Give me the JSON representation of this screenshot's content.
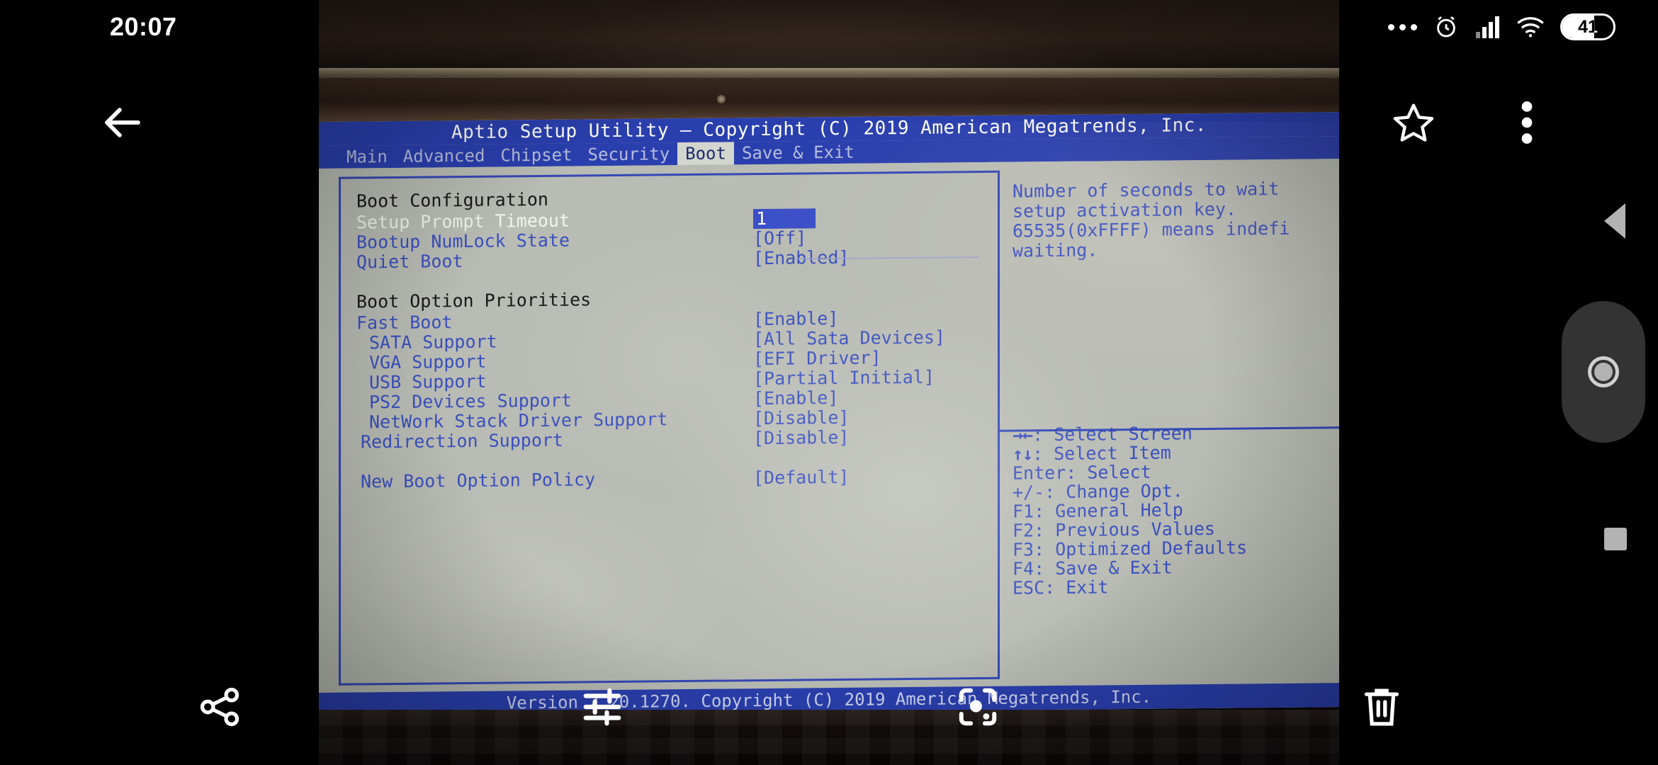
{
  "phone": {
    "status_bar": {
      "time": "20:07",
      "battery_percent": "41",
      "icons": [
        "more-dots-icon",
        "alarm-clock-icon",
        "signal-bars-icon",
        "wifi-icon",
        "battery-icon"
      ]
    },
    "top_actions": [
      {
        "name": "back-button",
        "icon": "arrow-left-icon"
      },
      {
        "name": "favorite-button",
        "icon": "star-icon"
      },
      {
        "name": "overflow-menu-button",
        "icon": "more-vertical-icon"
      }
    ],
    "bottom_actions": [
      {
        "name": "share-button",
        "icon": "share-icon"
      },
      {
        "name": "edit-button",
        "icon": "sliders-icon"
      },
      {
        "name": "lens-button",
        "icon": "google-lens-icon"
      },
      {
        "name": "delete-button",
        "icon": "trash-icon"
      }
    ],
    "nav_bar": [
      {
        "name": "nav-back-button",
        "icon": "triangle-left-icon"
      },
      {
        "name": "nav-home-button",
        "icon": "circle-icon"
      },
      {
        "name": "nav-recents-button",
        "icon": "square-icon"
      }
    ]
  },
  "bios": {
    "title": "Aptio Setup Utility – Copyright (C) 2019 American Megatrends, Inc.",
    "tabs": [
      {
        "label": "Main",
        "active": false
      },
      {
        "label": "Advanced",
        "active": false
      },
      {
        "label": "Chipset",
        "active": false
      },
      {
        "label": "Security",
        "active": false
      },
      {
        "label": "Boot",
        "active": true
      },
      {
        "label": "Save & Exit",
        "active": false
      }
    ],
    "sections": [
      {
        "heading": "Boot Configuration",
        "items": [
          {
            "label": "Setup Prompt Timeout",
            "value": "1",
            "selected": true,
            "indent": 0
          },
          {
            "label": "Bootup NumLock State",
            "value": "[Off]",
            "selected": false,
            "indent": 0
          },
          {
            "label": "Quiet Boot",
            "value": "[Enabled]",
            "selected": false,
            "indent": 0
          }
        ]
      },
      {
        "heading": "Boot Option Priorities",
        "items": [
          {
            "label": "Fast Boot",
            "value": "[Enable]",
            "selected": false,
            "indent": 0
          },
          {
            "label": "SATA Support",
            "value": "[All Sata Devices]",
            "selected": false,
            "indent": 1
          },
          {
            "label": "VGA Support",
            "value": "[EFI Driver]",
            "selected": false,
            "indent": 1
          },
          {
            "label": "USB Support",
            "value": "[Partial Initial]",
            "selected": false,
            "indent": 1
          },
          {
            "label": "PS2 Devices Support",
            "value": "[Enable]",
            "selected": false,
            "indent": 1
          },
          {
            "label": "NetWork Stack Driver Support",
            "value": "[Disable]",
            "selected": false,
            "indent": 1
          },
          {
            "label": "Redirection Support",
            "value": "[Disable]",
            "selected": false,
            "indent": 0
          },
          {
            "label": "",
            "value": "",
            "selected": false,
            "indent": 0
          },
          {
            "label": "New Boot Option Policy",
            "value": "[Default]",
            "selected": false,
            "indent": 0
          }
        ]
      }
    ],
    "help_lines": [
      "Number of seconds to wait",
      "setup activation key.",
      "65535(0xFFFF) means indefi",
      "waiting."
    ],
    "key_legend": [
      {
        "keys": "→←",
        "action": ": Select Screen"
      },
      {
        "keys": "↑↓",
        "action": ": Select Item"
      },
      {
        "keys": "Enter",
        "action": ": Select"
      },
      {
        "keys": "+/-",
        "action": ": Change Opt."
      },
      {
        "keys": "F1",
        "action": ": General Help"
      },
      {
        "keys": "F2",
        "action": ": Previous Values"
      },
      {
        "keys": "F3",
        "action": ": Optimized Defaults"
      },
      {
        "keys": "F4",
        "action": ": Save & Exit"
      },
      {
        "keys": "ESC",
        "action": ": Exit"
      }
    ],
    "footer": "Version 2.20.1270. Copyright (C) 2019 American Megatrends, Inc.",
    "colors": {
      "screen_bg": "#b9bcb4",
      "header_blue": "#2a3fae",
      "text_blue": "#3a4fbf",
      "heading_black": "#181818",
      "selected_bg": "#3b4fc8",
      "selected_text": "#ffffff"
    }
  }
}
